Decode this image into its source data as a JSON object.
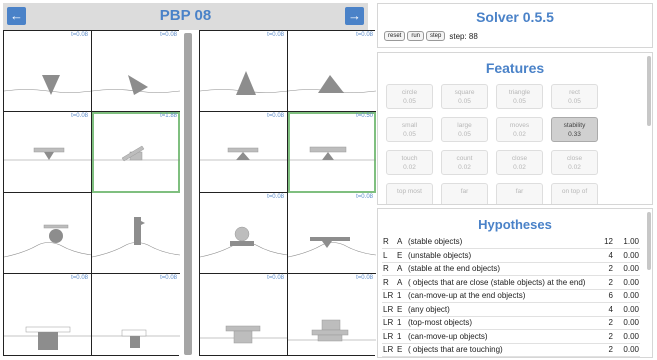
{
  "left_panel": {
    "title": "PBP 08",
    "prev_icon": "arrow-left-icon",
    "next_icon": "arrow-right-icon"
  },
  "scenes": {
    "left": [
      {
        "t": "t=0.08",
        "selected": false
      },
      {
        "t": "t=0.08",
        "selected": false
      },
      {
        "t": "t=0.08",
        "selected": false
      },
      {
        "t": "t=1.88",
        "selected": true
      },
      {
        "t": "",
        "selected": false
      },
      {
        "t": "",
        "selected": false
      },
      {
        "t": "t=0.08",
        "selected": false
      },
      {
        "t": "t=0.08",
        "selected": false
      }
    ],
    "right": [
      {
        "t": "t=0.08",
        "selected": false
      },
      {
        "t": "t=0.08",
        "selected": false
      },
      {
        "t": "t=0.08",
        "selected": false
      },
      {
        "t": "t=0.50",
        "selected": true
      },
      {
        "t": "t=0.08",
        "selected": false
      },
      {
        "t": "t=0.08",
        "selected": false
      },
      {
        "t": "t=0.08",
        "selected": false
      },
      {
        "t": "t=0.08",
        "selected": false
      }
    ]
  },
  "solver": {
    "title": "Solver 0.5.5",
    "reset_label": "reset",
    "run_label": "run",
    "step_label": "step",
    "step_text": "step: 88"
  },
  "features": {
    "title": "Features",
    "items": [
      {
        "name": "circle",
        "value": "0.05",
        "active": false
      },
      {
        "name": "square",
        "value": "0.05",
        "active": false
      },
      {
        "name": "triangle",
        "value": "0.05",
        "active": false
      },
      {
        "name": "rect",
        "value": "0.05",
        "active": false
      },
      {
        "name": "small",
        "value": "0.05",
        "active": false
      },
      {
        "name": "large",
        "value": "0.05",
        "active": false
      },
      {
        "name": "moves",
        "value": "0.02",
        "active": false
      },
      {
        "name": "stability",
        "value": "0.33",
        "active": true
      },
      {
        "name": "touch",
        "value": "0.02",
        "active": false
      },
      {
        "name": "count",
        "value": "0.02",
        "active": false
      },
      {
        "name": "close",
        "value": "0.02",
        "active": false
      },
      {
        "name": "close",
        "value": "0.02",
        "active": false
      },
      {
        "name": "top most",
        "value": "",
        "active": false
      },
      {
        "name": "far",
        "value": "",
        "active": false
      },
      {
        "name": "far",
        "value": "",
        "active": false
      },
      {
        "name": "on top of",
        "value": "",
        "active": false
      }
    ]
  },
  "hypotheses": {
    "title": "Hypotheses",
    "rows": [
      {
        "side": "R",
        "type": "A",
        "text": "(stable objects)",
        "count": "12",
        "score": "1.00"
      },
      {
        "side": "L",
        "type": "E",
        "text": "(unstable objects)",
        "count": "4",
        "score": "0.00"
      },
      {
        "side": "R",
        "type": "A",
        "text": "(stable at the end objects)",
        "count": "2",
        "score": "0.00"
      },
      {
        "side": "R",
        "type": "A",
        "text": "( objects that are close (stable objects) at the end)",
        "count": "2",
        "score": "0.00"
      },
      {
        "side": "LR",
        "type": "1",
        "text": "(can-move-up at the end objects)",
        "count": "6",
        "score": "0.00"
      },
      {
        "side": "LR",
        "type": "E",
        "text": "(any object)",
        "count": "4",
        "score": "0.00"
      },
      {
        "side": "LR",
        "type": "1",
        "text": "(top-most objects)",
        "count": "2",
        "score": "0.00"
      },
      {
        "side": "LR",
        "type": "1",
        "text": "(can-move-up objects)",
        "count": "2",
        "score": "0.00"
      },
      {
        "side": "LR",
        "type": "E",
        "text": "( objects that are touching)",
        "count": "2",
        "score": "0.00"
      }
    ]
  }
}
